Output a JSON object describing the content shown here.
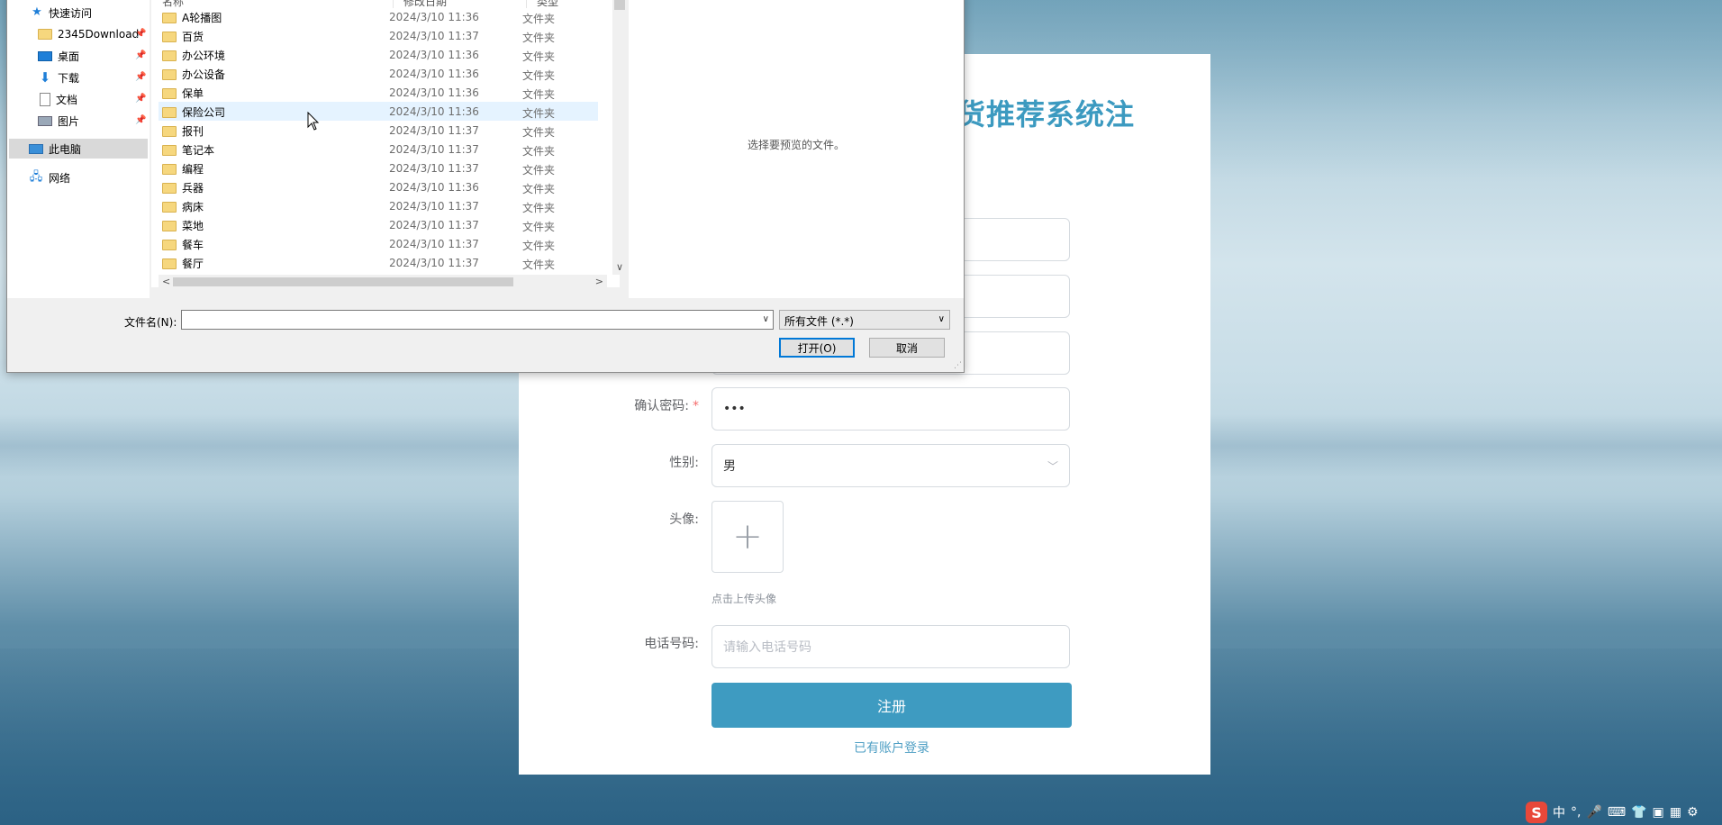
{
  "register": {
    "title": "货推荐系统注",
    "confirm_password_label": "确认密码:",
    "required_mark": "*",
    "confirm_password_value": "•••",
    "gender_label": "性别:",
    "gender_value": "男",
    "avatar_label": "头像:",
    "avatar_plus": "+",
    "avatar_tip": "点击上传头像",
    "phone_label": "电话号码:",
    "phone_placeholder": "请输入电话号码",
    "submit_label": "注册",
    "login_link": "已有账户登录"
  },
  "dialog": {
    "nav": {
      "quick_access": "快速访问",
      "items": [
        {
          "label": "2345Download",
          "icon": "folder-icon"
        },
        {
          "label": "桌面",
          "icon": "desktop-icon"
        },
        {
          "label": "下载",
          "icon": "download-icon"
        },
        {
          "label": "文档",
          "icon": "document-icon"
        },
        {
          "label": "图片",
          "icon": "pictures-icon"
        }
      ],
      "this_pc": "此电脑",
      "network": "网络"
    },
    "columns": {
      "name": "名称",
      "date": "修改日期",
      "type": "类型"
    },
    "files": [
      {
        "name": "A轮播图",
        "date": "2024/3/10 11:36",
        "type": "文件夹"
      },
      {
        "name": "百货",
        "date": "2024/3/10 11:37",
        "type": "文件夹"
      },
      {
        "name": "办公环境",
        "date": "2024/3/10 11:36",
        "type": "文件夹"
      },
      {
        "name": "办公设备",
        "date": "2024/3/10 11:36",
        "type": "文件夹"
      },
      {
        "name": "保单",
        "date": "2024/3/10 11:36",
        "type": "文件夹"
      },
      {
        "name": "保险公司",
        "date": "2024/3/10 11:36",
        "type": "文件夹"
      },
      {
        "name": "报刊",
        "date": "2024/3/10 11:37",
        "type": "文件夹"
      },
      {
        "name": "笔记本",
        "date": "2024/3/10 11:37",
        "type": "文件夹"
      },
      {
        "name": "编程",
        "date": "2024/3/10 11:37",
        "type": "文件夹"
      },
      {
        "name": "兵器",
        "date": "2024/3/10 11:36",
        "type": "文件夹"
      },
      {
        "name": "病床",
        "date": "2024/3/10 11:37",
        "type": "文件夹"
      },
      {
        "name": "菜地",
        "date": "2024/3/10 11:37",
        "type": "文件夹"
      },
      {
        "name": "餐车",
        "date": "2024/3/10 11:37",
        "type": "文件夹"
      },
      {
        "name": "餐厅",
        "date": "2024/3/10 11:37",
        "type": "文件夹"
      }
    ],
    "preview_text": "选择要预览的文件。",
    "filename_label": "文件名(N):",
    "filename_value": "",
    "filetype_value": "所有文件 (*.*)",
    "open_label": "打开(O)",
    "cancel_label": "取消"
  },
  "tray": {
    "ime_mode": "中",
    "punct": "°,"
  }
}
